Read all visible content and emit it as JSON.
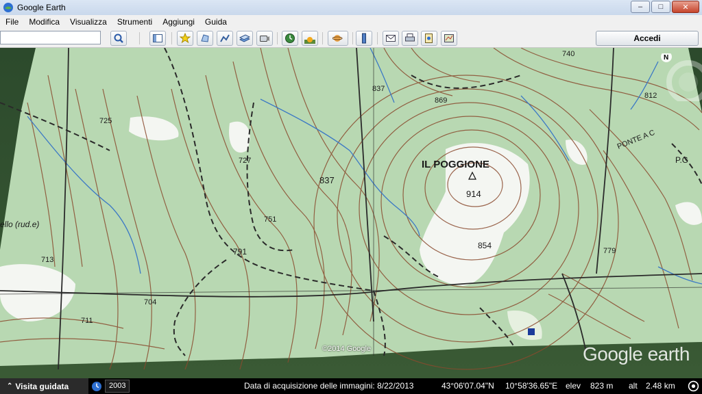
{
  "window": {
    "title": "Google Earth",
    "buttons": [
      "–",
      "□",
      "✕"
    ]
  },
  "menu": [
    "File",
    "Modifica",
    "Visualizza",
    "Strumenti",
    "Aggiungi",
    "Guida"
  ],
  "toolbar": {
    "search_value": "",
    "buttons": [
      "search-icon",
      "sidebar-icon",
      "placemark-icon",
      "polygon-icon",
      "path-icon",
      "overlay-icon",
      "record-tour-icon",
      "historical-imagery-icon",
      "sunlight-icon",
      "planets-icon",
      "ruler-icon",
      "email-icon",
      "print-icon",
      "save-image-icon",
      "view-in-maps-icon"
    ],
    "signin_label": "Accedi"
  },
  "map": {
    "labels": {
      "peak_name": "IL POGGIONE",
      "peak_elev": "914",
      "e837a": "837",
      "e837b": "837",
      "e869": "869",
      "e725": "725",
      "e727": "727",
      "e751": "751",
      "e791": "791",
      "e854": "854",
      "e779": "779",
      "e713": "713",
      "e711": "711",
      "e704": "704",
      "e740": "740",
      "e812": "812",
      "ruder": "ello (rud.e)",
      "ponte": "PONTE A C",
      "pg": "P.G",
      "north": "N"
    },
    "copyright": "©2014 Google",
    "logo": "Google earth"
  },
  "status": {
    "tour_label": "Visita guidata",
    "year": "2003",
    "imagery_date": "Data di acquisizione delle immagini: 8/22/2013",
    "lat": "43°06'07.04\"N",
    "lon": "10°58'36.65\"E",
    "elev_label": "elev",
    "elev_value": "823 m",
    "alt_label": "alt",
    "alt_value": "2.48 km"
  },
  "colors": {
    "map_green": "#b8d8b2",
    "contour": "#8a4a2e",
    "road": "#2a2a2a",
    "stream": "#3b78c5"
  }
}
